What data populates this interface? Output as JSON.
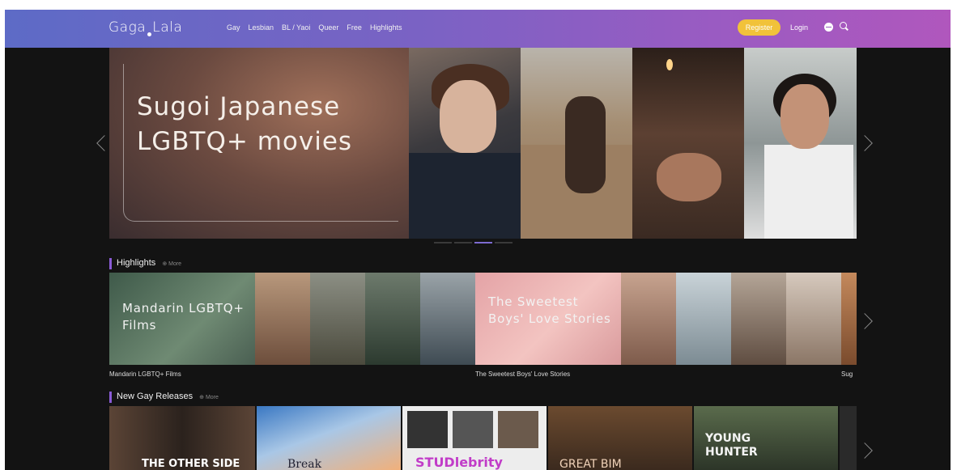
{
  "nav": {
    "logo_left": "Gaga",
    "logo_right": "Lala",
    "links": [
      "Gay",
      "Lesbian",
      "BL / Yaoi",
      "Queer",
      "Free",
      "Highlights"
    ],
    "register_label": "Register",
    "login_label": "Login"
  },
  "hero": {
    "title": "Sugoi Japanese LGBTQ+ movies",
    "slide_count": 4,
    "active_slide": 2
  },
  "highlights": {
    "heading": "Highlights",
    "more_label": "More",
    "cards": [
      {
        "title": "Mandarin LGBTQ+ Films",
        "caption": "Mandarin LGBTQ+ Films"
      },
      {
        "title": "The Sweetest Boys' Love Stories",
        "caption": "The Sweetest Boys'  Love Stories"
      },
      {
        "caption": "Sug"
      }
    ]
  },
  "new_gay": {
    "heading": "New Gay Releases",
    "more_label": "More",
    "posters": [
      {
        "title": "THE OTHER SIDE"
      },
      {
        "title": "Break"
      },
      {
        "title": "STUDlebrity"
      },
      {
        "title": "GREAT BIM"
      },
      {
        "title": "YOUNG HUNTER"
      }
    ]
  },
  "colors": {
    "nav_gradient_start": "#5d6bc6",
    "nav_gradient_end": "#b057bd",
    "register_bg": "#f1c23a",
    "section_accent": "#8a5bd6",
    "page_bg": "#131313"
  }
}
